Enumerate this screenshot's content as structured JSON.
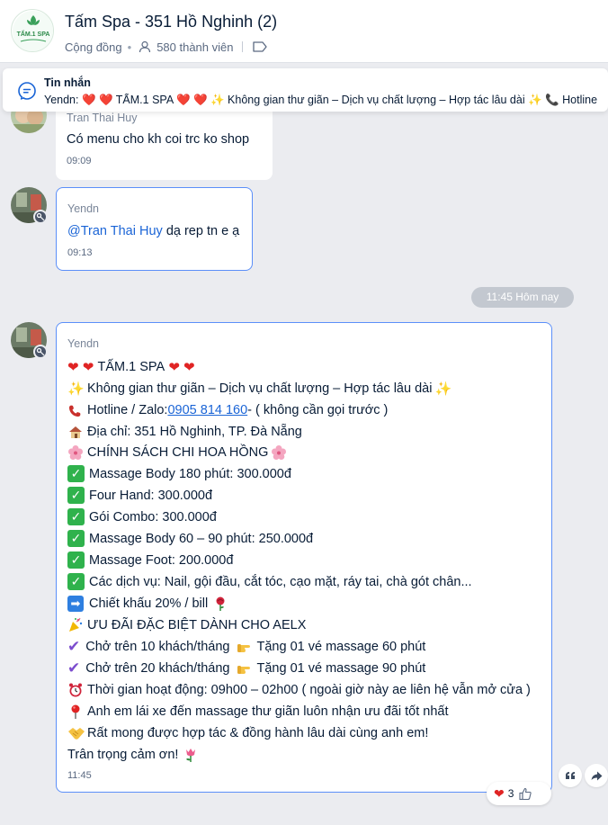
{
  "header": {
    "title": "Tấm Spa - 351 Hồ Nghinh (2)",
    "community_label": "Cộng đồng",
    "separator": "•",
    "member_count": "580 thành viên",
    "logo_text": "TẤM.1 SPA"
  },
  "pinned": {
    "label": "Tin nhắn",
    "text": "Yendn: ❤️ ❤️ TẤM.1 SPA ❤️ ❤️ ✨ Không gian thư giãn – Dịch vụ chất lượng – Hợp tác lâu dài ✨ 📞 Hotline"
  },
  "messages": [
    {
      "sender": "Tran Thai Huy",
      "text": "Có menu cho kh coi trc ko shop",
      "time": "09:09"
    },
    {
      "sender": "Yendn",
      "mention": "@Tran Thai Huy",
      "text": " dạ rep tn e ạ",
      "time": "09:13"
    }
  ],
  "time_divider": "11:45 Hôm nay",
  "long_message": {
    "sender": "Yendn",
    "lines": {
      "l1": "TẤM.1 SPA",
      "l2": "Không gian thư giãn – Dịch vụ chất lượng – Hợp tác lâu dài",
      "l3_prefix": "Hotline / Zalo: ",
      "l3_phone": "0905 814 160",
      "l3_suffix": " - ( không cần gọi trước )",
      "l4": "Địa chỉ: 351 Hồ Nghinh, TP. Đà Nẵng",
      "l5": "CHÍNH SÁCH CHI HOA HỒNG",
      "l6": "Massage Body 180 phút: 300.000đ",
      "l7": "Four Hand: 300.000đ",
      "l8": "Gói Combo: 300.000đ",
      "l9": "Massage Body 60 – 90 phút: 250.000đ",
      "l10": "Massage Foot: 200.000đ",
      "l11": "Các dịch vụ: Nail, gội đầu, cắt tóc, cạo mặt, ráy tai, chà gót chân...",
      "l12": "Chiết khấu 20% / bill",
      "l13": "ƯU ĐÃI ĐẶC BIỆT DÀNH CHO AELX",
      "l14a": "Chở trên 10 khách/tháng",
      "l14b": "Tặng 01 vé massage 60 phút",
      "l15a": "Chở trên 20 khách/tháng",
      "l15b": "Tặng 01 vé massage 90 phút",
      "l16": "Thời gian hoạt động: 09h00 – 02h00 ( ngoài giờ này ae liên hệ vẫn mở cửa )",
      "l17": "Anh em lái xe đến massage thư giãn luôn nhận ưu đãi tốt nhất",
      "l18": "Rất mong được hợp tác & đồng hành lâu dài cùng anh em!",
      "l19": "Trân trọng cảm ơn!"
    },
    "time": "11:45"
  },
  "reaction": {
    "emoji": "❤️",
    "count": "3"
  },
  "colors": {
    "accent": "#1a64d6",
    "own_border": "#5b8ff9",
    "background": "#ebecf0",
    "check_green": "#2fb24c"
  }
}
